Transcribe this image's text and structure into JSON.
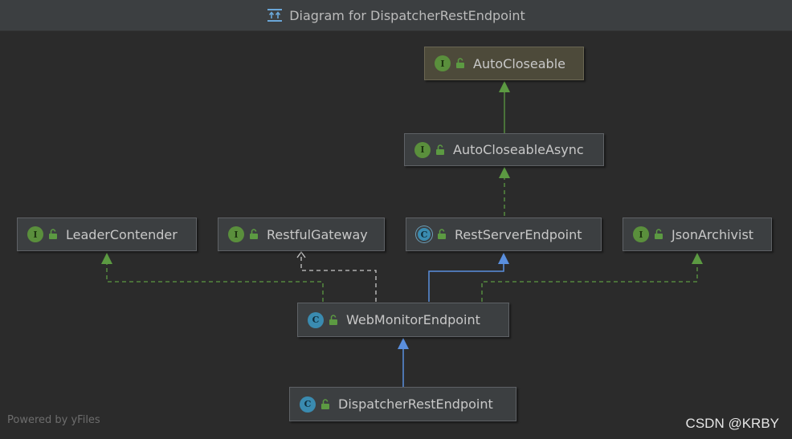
{
  "window": {
    "title": "Diagram for DispatcherRestEndpoint",
    "title_icon": "class-diagram-icon"
  },
  "nodes": {
    "auto_closeable": {
      "label": "AutoCloseable",
      "kind": "interface",
      "badge": "I"
    },
    "auto_closeable_async": {
      "label": "AutoCloseableAsync",
      "kind": "interface",
      "badge": "I"
    },
    "leader_contender": {
      "label": "LeaderContender",
      "kind": "interface",
      "badge": "I"
    },
    "restful_gateway": {
      "label": "RestfulGateway",
      "kind": "interface",
      "badge": "I"
    },
    "rest_server_endpoint": {
      "label": "RestServerEndpoint",
      "kind": "abstract-class",
      "badge": "C"
    },
    "json_archivist": {
      "label": "JsonArchivist",
      "kind": "interface",
      "badge": "I"
    },
    "web_monitor_endpoint": {
      "label": "WebMonitorEndpoint",
      "kind": "class",
      "badge": "C"
    },
    "dispatcher_rest_endpoint": {
      "label": "DispatcherRestEndpoint",
      "kind": "class",
      "badge": "C"
    }
  },
  "edges": [
    {
      "from": "auto_closeable_async",
      "to": "auto_closeable",
      "relation": "extends"
    },
    {
      "from": "rest_server_endpoint",
      "to": "auto_closeable_async",
      "relation": "implements"
    },
    {
      "from": "web_monitor_endpoint",
      "to": "leader_contender",
      "relation": "implements"
    },
    {
      "from": "web_monitor_endpoint",
      "to": "restful_gateway",
      "relation": "implements"
    },
    {
      "from": "web_monitor_endpoint",
      "to": "rest_server_endpoint",
      "relation": "extends"
    },
    {
      "from": "web_monitor_endpoint",
      "to": "json_archivist",
      "relation": "implements"
    },
    {
      "from": "dispatcher_rest_endpoint",
      "to": "web_monitor_endpoint",
      "relation": "extends"
    }
  ],
  "colors": {
    "background": "#2b2b2b",
    "interface_edge": "#5c9a42",
    "extends_edge": "#5a8fde",
    "gateway_edge": "#c8c8c8",
    "interface_badge": "#5a8f3c",
    "class_badge": "#3a8bb0"
  },
  "footer": {
    "powered_by": "Powered by yFiles",
    "watermark": "CSDN @KRBY"
  }
}
